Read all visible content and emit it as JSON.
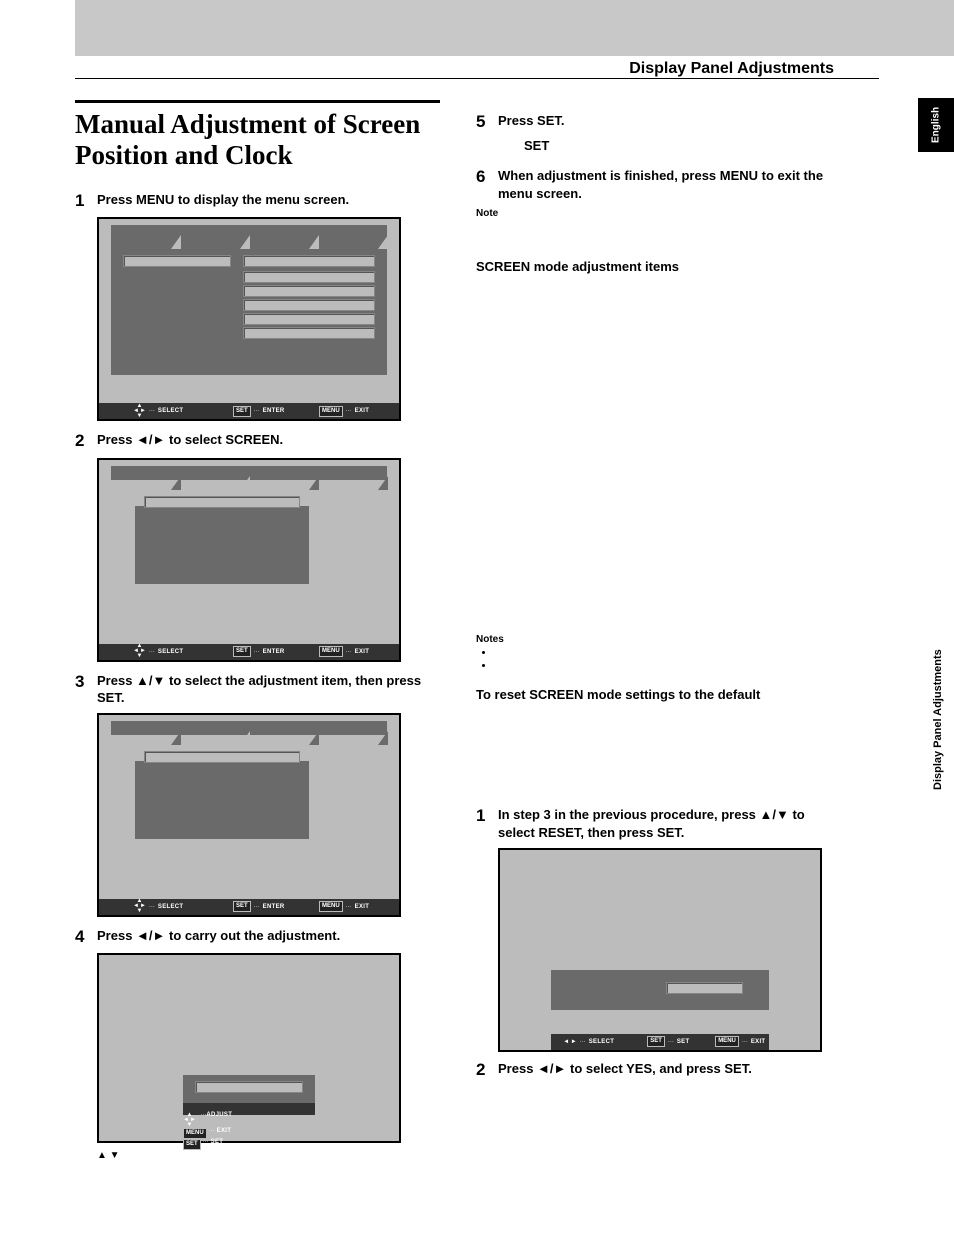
{
  "header": {
    "section": "Display Panel Adjustments"
  },
  "tabs": {
    "lang": "English",
    "side": "Display Panel Adjustments"
  },
  "title": "Manual Adjustment of Screen Position and Clock",
  "steps_left": [
    {
      "n": "1",
      "t": "Press MENU to display the menu screen."
    },
    {
      "n": "2",
      "t": "Press ◄/► to select SCREEN."
    },
    {
      "n": "3",
      "t": "Press ▲/▼ to select the adjustment item, then press SET."
    },
    {
      "n": "4",
      "t": "Press ◄/► to carry out the adjustment."
    }
  ],
  "after4": "▲ ▼",
  "steps_right": [
    {
      "n": "5",
      "t": "Press SET."
    },
    {
      "n": "6",
      "t": "When adjustment is finished, press MENU to exit the menu screen."
    }
  ],
  "set_indent": "SET",
  "note_label": "Note",
  "right_sub1": "SCREEN mode adjustment items",
  "notes_label": "Notes",
  "right_sub2": "To reset SCREEN mode settings to the default",
  "reset_steps": [
    {
      "n": "1",
      "t": "In step 3 in the previous procedure, press ▲/▼ to select RESET, then press SET."
    },
    {
      "n": "2",
      "t": "Press ◄/► to select YES, and press SET."
    }
  ],
  "osd": {
    "bar": {
      "select": "SELECT",
      "enter": "ENTER",
      "exit": "EXIT",
      "adjust": "ADJUST",
      "set_lab": "SET",
      "menu": "MENU",
      "set": "SET"
    }
  }
}
